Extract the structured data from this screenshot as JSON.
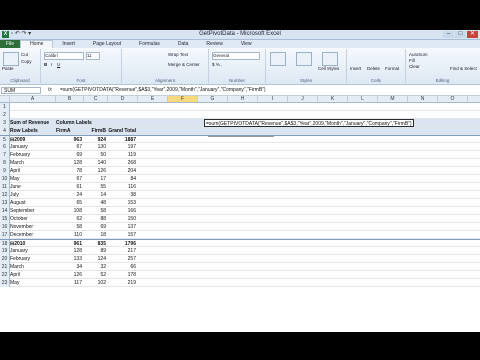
{
  "window": {
    "title": "GetPivotData - Microsoft Excel",
    "app_icon": "X",
    "min": "–",
    "max": "□",
    "close": "✕"
  },
  "quick_access": "▫ ↶ ↷ ▾",
  "tabs": [
    "File",
    "Home",
    "Insert",
    "Page Layout",
    "Formulas",
    "Data",
    "Review",
    "View"
  ],
  "ribbon": {
    "clipboard": {
      "label": "Clipboard",
      "cut": "Cut",
      "copy": "Copy",
      "paste": "Paste"
    },
    "font": {
      "label": "Font",
      "name": "Calibri",
      "size": "11"
    },
    "alignment": {
      "label": "Alignment",
      "wrap": "Wrap Text",
      "merge": "Merge & Center"
    },
    "number": {
      "label": "Number",
      "format": "General"
    },
    "styles": {
      "label": "Styles",
      "cond": "Conditional Formatting",
      "table": "Format as Table",
      "cell": "Cell Styles"
    },
    "cells": {
      "label": "Cells",
      "insert": "Insert",
      "delete": "Delete",
      "format": "Format"
    },
    "editing": {
      "label": "Editing",
      "autosum": "AutoSum",
      "fill": "Fill",
      "clear": "Clear",
      "sort": "Sort & Filter",
      "find": "Find & Select"
    }
  },
  "formula_bar": {
    "name_box": "SUM",
    "fx": "fx",
    "formula": "=sum(GETPIVOTDATA(\"Revenue\",$A$3,\"Year\",2009,\"Month\",\"January\",\"Company\",\"FirmB\")"
  },
  "columns": [
    "A",
    "B",
    "C",
    "D",
    "E",
    "F",
    "G",
    "H",
    "I",
    "J",
    "K",
    "L",
    "M",
    "N",
    "O",
    "P"
  ],
  "active_column": "F",
  "edit_cell": {
    "text": "=sum(GETPIVOTDATA(\"Revenue\",$A$3,\"Year\",2009,\"Month\",\"January\",\"Company\",\"FirmB\")",
    "tooltip": "SUM(number1, [number2], ...)"
  },
  "pivot": {
    "sum_label": "Sum of Revenue",
    "col_labels": "Column Labels",
    "row_labels": "Row Labels",
    "firmA": "FirmA",
    "firmB": "FirmB",
    "grand_total": "Grand Total",
    "rows": [
      {
        "r": "1",
        "label": "",
        "a": "",
        "b": "",
        "t": ""
      },
      {
        "r": "2",
        "label": "",
        "a": "",
        "b": "",
        "t": ""
      },
      {
        "r": "3",
        "type": "h1"
      },
      {
        "r": "4",
        "type": "h2"
      },
      {
        "r": "5",
        "label": "⊟2009",
        "a": "963",
        "b": "924",
        "t": "1887",
        "year": true
      },
      {
        "r": "6",
        "label": "January",
        "a": "67",
        "b": "130",
        "t": "197"
      },
      {
        "r": "7",
        "label": "February",
        "a": "69",
        "b": "50",
        "t": "119"
      },
      {
        "r": "8",
        "label": "March",
        "a": "128",
        "b": "140",
        "t": "268"
      },
      {
        "r": "9",
        "label": "April",
        "a": "78",
        "b": "126",
        "t": "204"
      },
      {
        "r": "10",
        "label": "May",
        "a": "67",
        "b": "17",
        "t": "84"
      },
      {
        "r": "11",
        "label": "June",
        "a": "61",
        "b": "55",
        "t": "116"
      },
      {
        "r": "12",
        "label": "July",
        "a": "24",
        "b": "14",
        "t": "38"
      },
      {
        "r": "13",
        "label": "August",
        "a": "65",
        "b": "48",
        "t": "153"
      },
      {
        "r": "14",
        "label": "September",
        "a": "108",
        "b": "58",
        "t": "166"
      },
      {
        "r": "15",
        "label": "October",
        "a": "62",
        "b": "88",
        "t": "150"
      },
      {
        "r": "16",
        "label": "November",
        "a": "58",
        "b": "69",
        "t": "137"
      },
      {
        "r": "17",
        "label": "December",
        "a": "110",
        "b": "18",
        "t": "157"
      },
      {
        "r": "18",
        "label": "⊟2010",
        "a": "961",
        "b": "835",
        "t": "1796",
        "year": true
      },
      {
        "r": "19",
        "label": "January",
        "a": "128",
        "b": "89",
        "t": "217"
      },
      {
        "r": "20",
        "label": "February",
        "a": "133",
        "b": "124",
        "t": "257"
      },
      {
        "r": "21",
        "label": "March",
        "a": "34",
        "b": "32",
        "t": "66"
      },
      {
        "r": "22",
        "label": "April",
        "a": "126",
        "b": "52",
        "t": "178"
      },
      {
        "r": "23",
        "label": "May",
        "a": "117",
        "b": "102",
        "t": "219"
      }
    ]
  }
}
